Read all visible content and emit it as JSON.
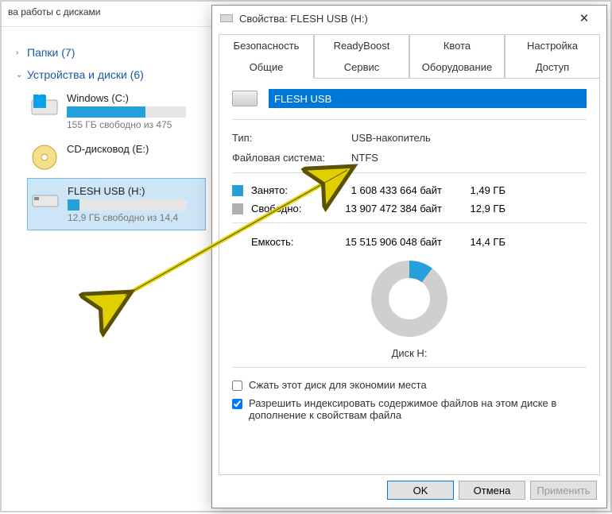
{
  "explorer": {
    "toolbar_text": "ва работы с дисками",
    "folders": {
      "label": "Папки",
      "count": "(7)"
    },
    "devices": {
      "label": "Устройства и диски",
      "count": "(6)"
    },
    "drives": [
      {
        "name": "Windows (C:)",
        "free": "155 ГБ свободно из 475",
        "fill_pct": 66
      },
      {
        "name": "CD-дисковод (E:)",
        "free": "",
        "fill_pct": 0,
        "is_cd": true
      },
      {
        "name": "FLESH USB (H:)",
        "free": "12,9 ГБ свободно из 14,4",
        "fill_pct": 10,
        "selected": true
      }
    ]
  },
  "dialog": {
    "title": "Свойства: FLESH USB (H:)",
    "tabs_row1": [
      "Безопасность",
      "ReadyBoost",
      "Квота",
      "Настройка"
    ],
    "tabs_row2": [
      "Общие",
      "Сервис",
      "Оборудование",
      "Доступ"
    ],
    "active_tab": "Общие",
    "name_value": "FLESH USB",
    "type_label": "Тип:",
    "type_value": "USB-накопитель",
    "fs_label": "Файловая система:",
    "fs_value": "NTFS",
    "used_label": "Занято:",
    "used_bytes": "1 608 433 664 байт",
    "used_gb": "1,49 ГБ",
    "free_label": "Свободно:",
    "free_bytes": "13 907 472 384 байт",
    "free_gb": "12,9 ГБ",
    "cap_label": "Емкость:",
    "cap_bytes": "15 515 906 048 байт",
    "cap_gb": "14,4 ГБ",
    "pie_label": "Диск H:",
    "compress_label": "Сжать этот диск для экономии места",
    "index_label": "Разрешить индексировать содержимое файлов на этом диске в дополнение к свойствам файла",
    "btn_ok": "OK",
    "btn_cancel": "Отмена",
    "btn_apply": "Применить"
  },
  "colors": {
    "accent": "#26a0da",
    "selected": "#cde6f7"
  }
}
